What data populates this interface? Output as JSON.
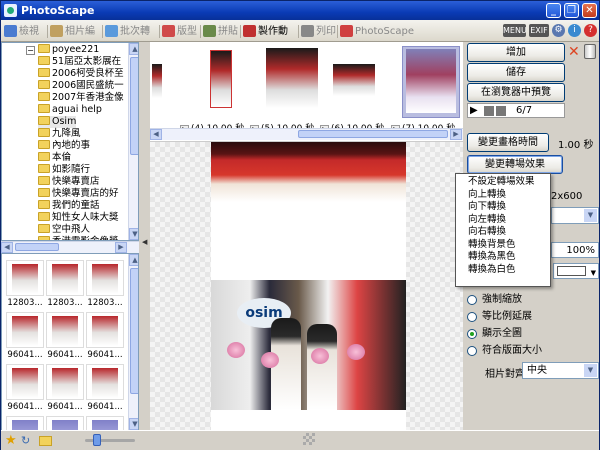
{
  "window": {
    "title": "PhotoScape"
  },
  "tabs": [
    {
      "label": "檢視",
      "color": "#4a7bd0"
    },
    {
      "label": "相片編修",
      "color": "#c0a060"
    },
    {
      "label": "批次轉換",
      "color": "#5a9adc"
    },
    {
      "label": "版型",
      "color": "#d04a4a"
    },
    {
      "label": "拼貼",
      "color": "#6a8a4a"
    },
    {
      "label": "製作動畫",
      "color": "#c03030"
    },
    {
      "label": "列印",
      "color": "#888888"
    },
    {
      "label": "PhotoScape",
      "color": "#d04040"
    }
  ],
  "top_right_icons": [
    "menu-icon",
    "exif-icon",
    "settings-icon",
    "info-icon",
    "help-icon"
  ],
  "top_right_labels": {
    "menu": "MENU",
    "exif": "EXIF"
  },
  "folder_tree": {
    "root": "poyee221",
    "items": [
      "51屆亞太影展在",
      "2006柯受良杯至",
      "2006國民盛統一",
      "2007年香港金像",
      "aguai help",
      "Osim",
      "九降風",
      "內地的事",
      "本倫",
      "如影隨行",
      "快樂專賣店",
      "快樂專賣店的好",
      "我們的童話",
      "知性女人味大獎",
      "空中飛人",
      "香港電影金像獎"
    ],
    "selected": "Osim"
  },
  "file_thumbs": {
    "labels": [
      "12803...",
      "12803...",
      "12803...",
      "96041...",
      "96041...",
      "96041...",
      "96041...",
      "96041...",
      "96041..."
    ]
  },
  "strip": {
    "frames": [
      {
        "label": "(4) 10.00 秒"
      },
      {
        "label": "(5) 10.00 秒"
      },
      {
        "label": "(6) 10.00 秒"
      },
      {
        "label": "(7) 10.00 秒"
      }
    ],
    "selected_index": 3
  },
  "right": {
    "add": "增加",
    "save": "儲存",
    "preview_browser": "在瀏覽器中預覽",
    "counter": "6/7",
    "change_time": "變更畫格時間",
    "time_value": "1.00 秒",
    "change_transition": "變更轉場效果",
    "size_text": "2x600",
    "percent": "100%",
    "radios": [
      {
        "label": "強制縮放",
        "checked": false
      },
      {
        "label": "等比例延展",
        "checked": false
      },
      {
        "label": "顯示全圖",
        "checked": true
      },
      {
        "label": "符合版面大小",
        "checked": false
      }
    ],
    "align_label": "相片對齊",
    "align_value": "中央"
  },
  "transition_menu": [
    "不設定轉場效果",
    "向上轉換",
    "向下轉換",
    "向左轉換",
    "向右轉換",
    "轉換背景色",
    "轉換為黑色",
    "轉換為白色"
  ],
  "preview": {
    "brand": "osim"
  }
}
